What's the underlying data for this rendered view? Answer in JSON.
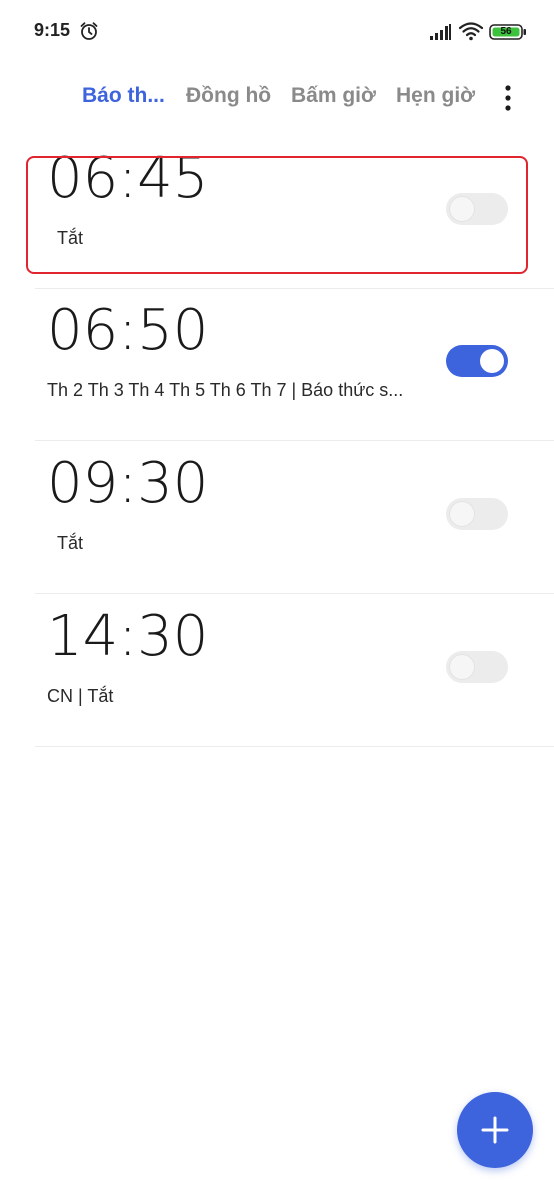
{
  "status_bar": {
    "time": "9:15",
    "alarm_icon": "alarm-clock-icon",
    "signal_icon": "cellular-signal-icon",
    "wifi_icon": "wifi-icon",
    "battery_level": "56",
    "battery_color": "#3cc23c"
  },
  "tabs": [
    {
      "label": "Báo th...",
      "active": true
    },
    {
      "label": "Đồng hồ",
      "active": false
    },
    {
      "label": "Bấm giờ",
      "active": false
    },
    {
      "label": "Hẹn giờ",
      "active": false
    }
  ],
  "more_icon": "more-vertical-icon",
  "alarms": [
    {
      "time": "06:45",
      "subtitle": "Tắt",
      "enabled": false,
      "highlighted": true
    },
    {
      "time": "06:50",
      "subtitle": "Th 2 Th 3 Th 4 Th 5 Th 6 Th 7  |  Báo thức s...",
      "enabled": true,
      "highlighted": false
    },
    {
      "time": "09:30",
      "subtitle": "Tắt",
      "enabled": false,
      "highlighted": false
    },
    {
      "time": "14:30",
      "subtitle": "CN  |  Tắt",
      "enabled": false,
      "highlighted": false
    }
  ],
  "fab_icon": "plus-icon",
  "colors": {
    "accent": "#3d63dd",
    "highlight_border": "#e0252e",
    "inactive_tab": "#8a8a8a"
  }
}
